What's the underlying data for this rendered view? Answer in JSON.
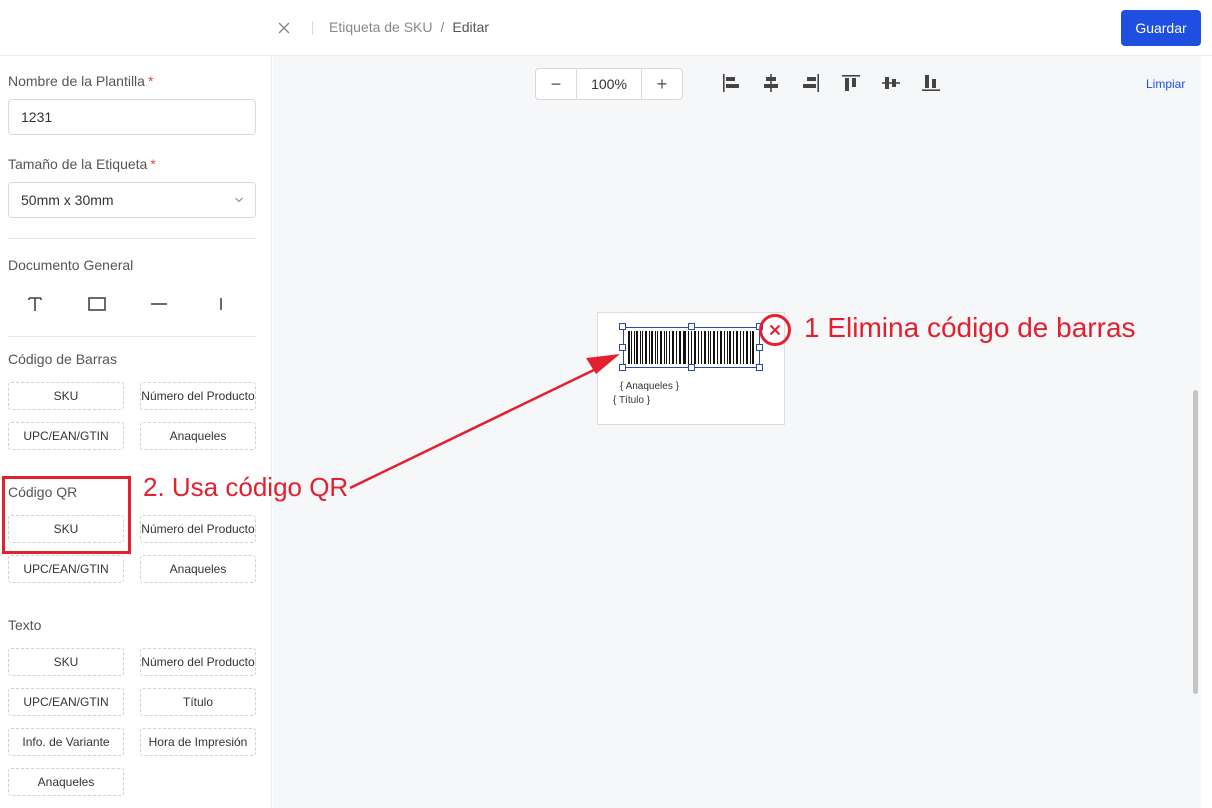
{
  "header": {
    "close_icon": "close-icon",
    "breadcrumb": [
      "Etiqueta de SKU",
      "Editar"
    ],
    "breadcrumb_separator": "/",
    "save_label": "Guardar"
  },
  "sidebar": {
    "template_name_label": "Nombre de la Plantilla",
    "template_name_value": "1231",
    "label_size_label": "Tamaño de la Etiqueta",
    "label_size_value": "50mm x 30mm",
    "required_mark": "*",
    "general_doc": {
      "title": "Documento General",
      "tools": [
        "text-tool-icon",
        "rectangle-tool-icon",
        "horizontal-line-icon",
        "vertical-line-icon"
      ]
    },
    "barcode": {
      "title": "Código de Barras",
      "items": [
        "SKU",
        "Número del Producto",
        "UPC/EAN/GTIN",
        "Anaqueles"
      ]
    },
    "qr": {
      "title": "Código QR",
      "items": [
        "SKU",
        "Número del Producto",
        "UPC/EAN/GTIN",
        "Anaqueles"
      ]
    },
    "text": {
      "title": "Texto",
      "items": [
        "SKU",
        "Número del Producto",
        "UPC/EAN/GTIN",
        "Título",
        "Info. de Variante",
        "Hora de Impresión",
        "Anaqueles"
      ]
    }
  },
  "toolbar": {
    "zoom_minus": "−",
    "zoom_value": "100%",
    "zoom_plus": "+",
    "align_icons": [
      "align-left-icon",
      "align-center-horizontal-icon",
      "align-right-icon",
      "align-top-icon",
      "align-center-vertical-icon",
      "align-bottom-icon"
    ],
    "clear_label": "Limpiar"
  },
  "label_preview": {
    "field1": "{ Anaqueles }",
    "field2": "{ Título }"
  },
  "annotations": {
    "step1": "1 Elimina código de barras",
    "step2": "2. Usa código QR",
    "color": "#e3202e"
  },
  "colors": {
    "primary": "#1f4fe0",
    "canvas_bg": "#f6f7f9",
    "selection": "#2b4aa8"
  }
}
